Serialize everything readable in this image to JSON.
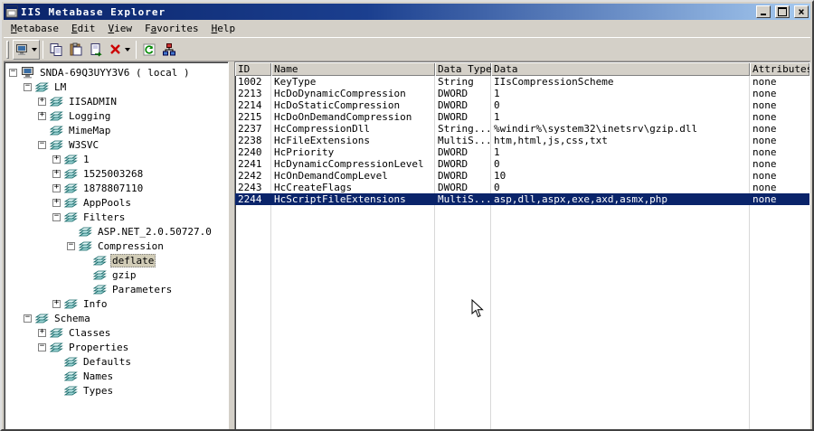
{
  "window": {
    "title": "IIS Metabase Explorer"
  },
  "menu": {
    "items": [
      {
        "pre": "",
        "accel": "M",
        "post": "etabase"
      },
      {
        "pre": "",
        "accel": "E",
        "post": "dit"
      },
      {
        "pre": "",
        "accel": "V",
        "post": "iew"
      },
      {
        "pre": "F",
        "accel": "a",
        "post": "vorites"
      },
      {
        "pre": "",
        "accel": "H",
        "post": "elp"
      }
    ]
  },
  "toolbar": {
    "buttons": [
      "connect",
      "copy",
      "paste",
      "export",
      "delete",
      "refresh",
      "network"
    ]
  },
  "tree": {
    "items": [
      {
        "label": "SNDA-69Q3UYY3V6 ( local )",
        "level": 0,
        "expander": "minus",
        "icon": "computer",
        "selected": false
      },
      {
        "label": "LM",
        "level": 1,
        "expander": "minus",
        "icon": "db",
        "selected": false
      },
      {
        "label": "IISADMIN",
        "level": 2,
        "expander": "plus",
        "icon": "db",
        "selected": false
      },
      {
        "label": "Logging",
        "level": 2,
        "expander": "plus",
        "icon": "db",
        "selected": false
      },
      {
        "label": "MimeMap",
        "level": 2,
        "expander": "none",
        "icon": "db",
        "selected": false
      },
      {
        "label": "W3SVC",
        "level": 2,
        "expander": "minus",
        "icon": "db",
        "selected": false
      },
      {
        "label": "1",
        "level": 3,
        "expander": "plus",
        "icon": "db",
        "selected": false
      },
      {
        "label": "1525003268",
        "level": 3,
        "expander": "plus",
        "icon": "db",
        "selected": false
      },
      {
        "label": "1878807110",
        "level": 3,
        "expander": "plus",
        "icon": "db",
        "selected": false
      },
      {
        "label": "AppPools",
        "level": 3,
        "expander": "plus",
        "icon": "db",
        "selected": false
      },
      {
        "label": "Filters",
        "level": 3,
        "expander": "minus",
        "icon": "db",
        "selected": false
      },
      {
        "label": "ASP.NET_2.0.50727.0",
        "level": 4,
        "expander": "none",
        "icon": "db",
        "selected": false
      },
      {
        "label": "Compression",
        "level": 4,
        "expander": "minus",
        "icon": "db",
        "selected": false
      },
      {
        "label": "deflate",
        "level": 5,
        "expander": "none",
        "icon": "db",
        "selected": true
      },
      {
        "label": "gzip",
        "level": 5,
        "expander": "none",
        "icon": "db",
        "selected": false
      },
      {
        "label": "Parameters",
        "level": 5,
        "expander": "none",
        "icon": "db",
        "selected": false
      },
      {
        "label": "Info",
        "level": 3,
        "expander": "plus",
        "icon": "db",
        "selected": false
      },
      {
        "label": "Schema",
        "level": 1,
        "expander": "minus",
        "icon": "db",
        "selected": false
      },
      {
        "label": "Classes",
        "level": 2,
        "expander": "plus",
        "icon": "db",
        "selected": false
      },
      {
        "label": "Properties",
        "level": 2,
        "expander": "minus",
        "icon": "db",
        "selected": false
      },
      {
        "label": "Defaults",
        "level": 3,
        "expander": "none",
        "icon": "db",
        "selected": false
      },
      {
        "label": "Names",
        "level": 3,
        "expander": "none",
        "icon": "db",
        "selected": false
      },
      {
        "label": "Types",
        "level": 3,
        "expander": "none",
        "icon": "db",
        "selected": false
      }
    ]
  },
  "table": {
    "columns": [
      "ID",
      "Name",
      "Data Type",
      "Data",
      "Attributes"
    ],
    "rows": [
      {
        "id": "1002",
        "name": "KeyType",
        "type": "String",
        "data": "IIsCompressionScheme",
        "attributes": "none",
        "selected": false
      },
      {
        "id": "2213",
        "name": "HcDoDynamicCompression",
        "type": "DWORD",
        "data": "1",
        "attributes": "none",
        "selected": false
      },
      {
        "id": "2214",
        "name": "HcDoStaticCompression",
        "type": "DWORD",
        "data": "0",
        "attributes": "none",
        "selected": false
      },
      {
        "id": "2215",
        "name": "HcDoOnDemandCompression",
        "type": "DWORD",
        "data": "1",
        "attributes": "none",
        "selected": false
      },
      {
        "id": "2237",
        "name": "HcCompressionDll",
        "type": "String...",
        "data": "%windir%\\system32\\inetsrv\\gzip.dll",
        "attributes": "none",
        "selected": false
      },
      {
        "id": "2238",
        "name": "HcFileExtensions",
        "type": "MultiS...",
        "data": "htm,html,js,css,txt",
        "attributes": "none",
        "selected": false
      },
      {
        "id": "2240",
        "name": "HcPriority",
        "type": "DWORD",
        "data": "1",
        "attributes": "none",
        "selected": false
      },
      {
        "id": "2241",
        "name": "HcDynamicCompressionLevel",
        "type": "DWORD",
        "data": "0",
        "attributes": "none",
        "selected": false
      },
      {
        "id": "2242",
        "name": "HcOnDemandCompLevel",
        "type": "DWORD",
        "data": "10",
        "attributes": "none",
        "selected": false
      },
      {
        "id": "2243",
        "name": "HcCreateFlags",
        "type": "DWORD",
        "data": "0",
        "attributes": "none",
        "selected": false
      },
      {
        "id": "2244",
        "name": "HcScriptFileExtensions",
        "type": "MultiS...",
        "data": "asp,dll,aspx,exe,axd,asmx,php",
        "attributes": "none",
        "selected": true
      }
    ]
  }
}
